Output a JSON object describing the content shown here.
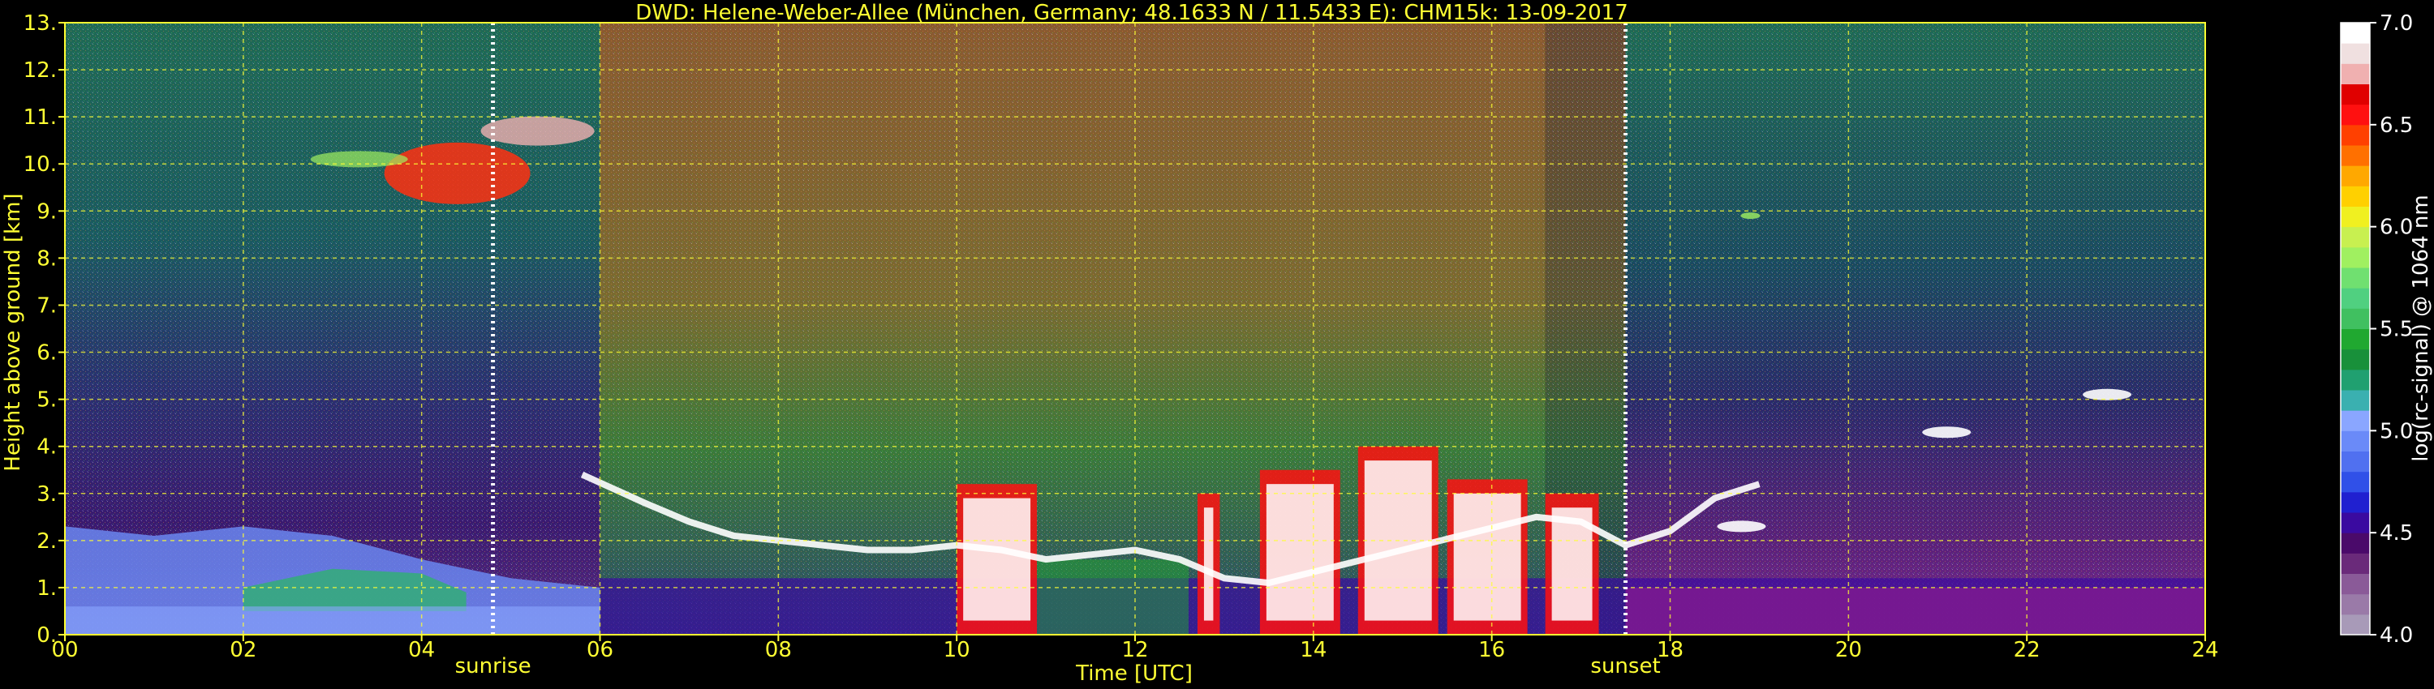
{
  "chart_data": {
    "type": "heatmap",
    "title": "DWD: Helene-Weber-Allee (München, Germany; 48.1633 N / 11.5433 E):    CHM15k: 13-09-2017",
    "xlabel": "Time [UTC]",
    "ylabel": "Height above ground [km]",
    "xlim": [
      0,
      24
    ],
    "ylim": [
      0,
      13
    ],
    "x_ticks": [
      "00",
      "02",
      "04",
      "06",
      "08",
      "10",
      "12",
      "14",
      "16",
      "18",
      "20",
      "22",
      "24"
    ],
    "y_ticks": [
      "0.",
      "1.",
      "2.",
      "3.",
      "4.",
      "5.",
      "6.",
      "7.",
      "8.",
      "9.",
      "10.",
      "11.",
      "12.",
      "13."
    ],
    "grid": true,
    "colorbar": {
      "label": "log(rc-signal) @ 1064 nm",
      "range": [
        4.0,
        7.0
      ],
      "ticks": [
        "4.0",
        "4.5",
        "5.0",
        "5.5",
        "6.0",
        "6.5",
        "7.0"
      ],
      "colors": [
        "#a89ab8",
        "#9a7aa8",
        "#8a5a98",
        "#6a2a7a",
        "#4a0a6a",
        "#3a0aa0",
        "#2020d0",
        "#3050e8",
        "#5070f0",
        "#6a8af8",
        "#8aa6ff",
        "#3ab0b0",
        "#20a070",
        "#18903a",
        "#20a830",
        "#40c060",
        "#50d080",
        "#70e070",
        "#a0f060",
        "#c8f050",
        "#f0f020",
        "#ffd000",
        "#ffa800",
        "#ff7000",
        "#ff4000",
        "#ff1010",
        "#e00000",
        "#f0b0b0",
        "#f0e0e0",
        "#ffffff"
      ]
    },
    "events": [
      {
        "label": "sunrise",
        "time": 4.8
      },
      {
        "label": "sunset",
        "time": 17.5
      }
    ],
    "cloud_base_km": [
      [
        5.8,
        3.4
      ],
      [
        6.5,
        2.8
      ],
      [
        7.0,
        2.4
      ],
      [
        7.5,
        2.1
      ],
      [
        8.0,
        2.0
      ],
      [
        8.5,
        1.9
      ],
      [
        9.0,
        1.8
      ],
      [
        9.5,
        1.8
      ],
      [
        10.0,
        1.9
      ],
      [
        10.5,
        1.8
      ],
      [
        11.0,
        1.6
      ],
      [
        11.5,
        1.7
      ],
      [
        12.0,
        1.8
      ],
      [
        12.5,
        1.6
      ],
      [
        13.0,
        1.2
      ],
      [
        13.5,
        1.1
      ],
      [
        16.5,
        2.5
      ],
      [
        17.0,
        2.4
      ],
      [
        17.5,
        1.9
      ],
      [
        18.0,
        2.2
      ],
      [
        18.5,
        2.9
      ],
      [
        19.0,
        3.2
      ]
    ]
  }
}
